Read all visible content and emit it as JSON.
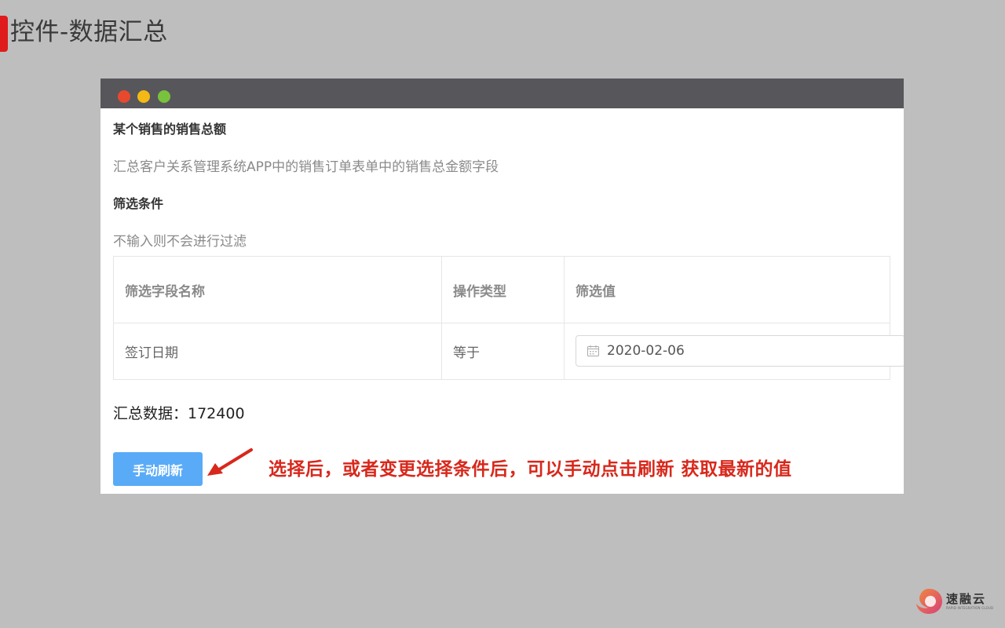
{
  "slide": {
    "title": "控件-数据汇总",
    "annotation": "选择后，或者变更选择条件后，可以手动点击刷新 获取最新的值"
  },
  "widget": {
    "title": "某个销售的销售总额",
    "description": "汇总客户关系管理系统APP中的销售订单表单中的销售总金额字段",
    "filter_heading": "筛选条件",
    "filter_hint": "不输入则不会进行过滤",
    "table": {
      "columns": [
        "筛选字段名称",
        "操作类型",
        "筛选值"
      ],
      "rows": [
        {
          "field": "签订日期",
          "operator": "等于",
          "value": "2020-02-06"
        }
      ]
    },
    "summary_text": "汇总数据：172400",
    "refresh_button": "手动刷新"
  },
  "window": {
    "traffic_lights": [
      "#e8492e",
      "#f4b915",
      "#79c23d"
    ]
  },
  "logo": {
    "name": "速融云",
    "tagline": "RAPID INTEGRATION CLOUD"
  },
  "colors": {
    "accent": "#e01b1b",
    "button": "#5aabf7",
    "annotation": "#d8281c"
  },
  "icons": {
    "date": "calendar-icon",
    "pointer": "arrow-icon"
  }
}
